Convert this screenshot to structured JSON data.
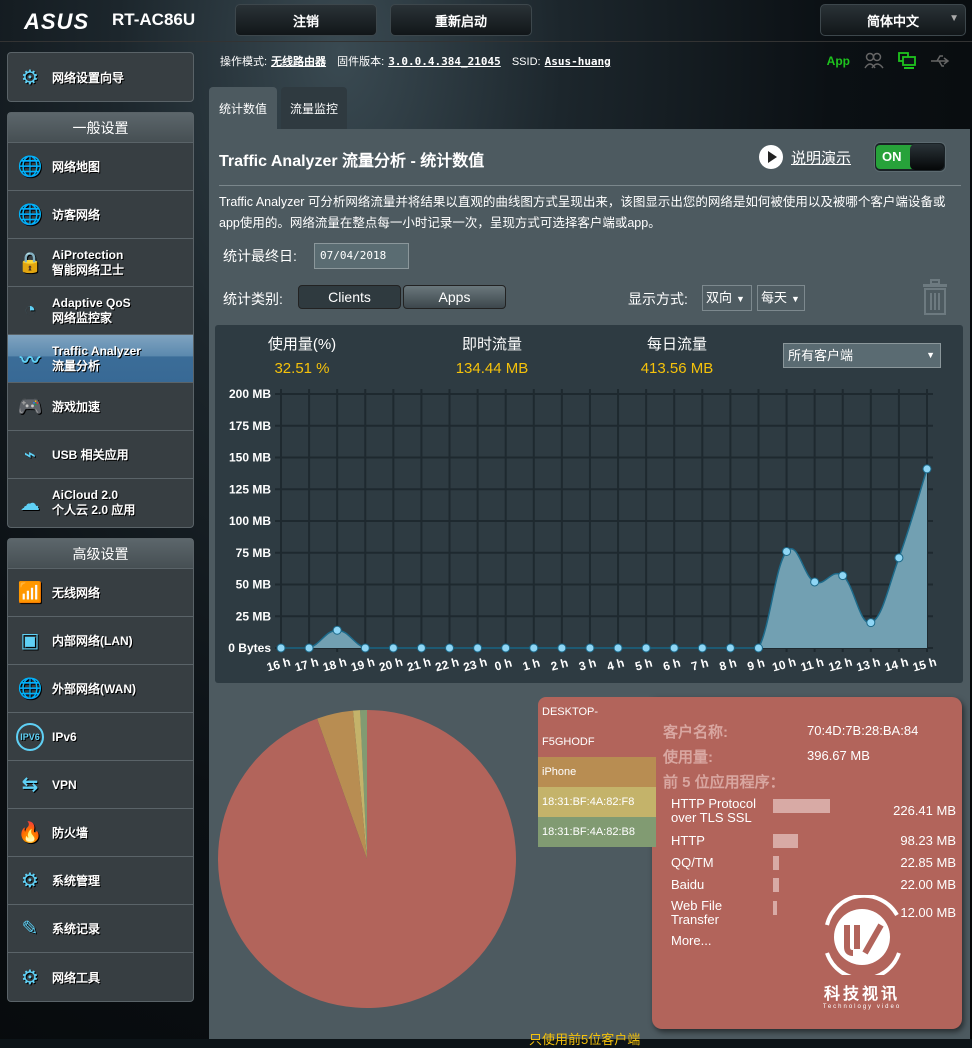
{
  "header": {
    "brand": "ASUS",
    "model": "RT-AC86U",
    "logout_label": "注销",
    "reboot_label": "重新启动",
    "language": "简体中文"
  },
  "status": {
    "mode_label": "操作模式:",
    "mode_value": "无线路由器",
    "firmware_label": "固件版本:",
    "firmware_value": "3.0.0.4.384_21045",
    "ssid_label": "SSID:",
    "ssid_value": "Asus-huang",
    "app_label": "App"
  },
  "sidebar": {
    "wizard": "网络设置向导",
    "general_title": "一般设置",
    "general": [
      {
        "label": "网络地图",
        "icon": "globe-pin-icon"
      },
      {
        "label": "访客网络",
        "icon": "guest-network-icon"
      },
      {
        "label": "AiProtection",
        "sub": "智能网络卫士",
        "icon": "shield-lock-icon"
      },
      {
        "label": "Adaptive QoS",
        "sub": "网络监控家",
        "icon": "speedometer-icon"
      },
      {
        "label": "Traffic Analyzer",
        "sub": "流量分析",
        "icon": "traffic-wave-icon",
        "active": true
      },
      {
        "label": "游戏加速",
        "icon": "gamepad-icon"
      },
      {
        "label": "USB 相关应用",
        "icon": "usb-icon"
      },
      {
        "label": "AiCloud 2.0",
        "sub": "个人云 2.0 应用",
        "icon": "cloud-icon"
      }
    ],
    "advanced_title": "高级设置",
    "advanced": [
      {
        "label": "无线网络",
        "icon": "wireless-icon"
      },
      {
        "label": "内部网络(LAN)",
        "icon": "lan-port-icon"
      },
      {
        "label": "外部网络(WAN)",
        "icon": "globe-icon"
      },
      {
        "label": "IPv6",
        "icon": "ipv6-icon"
      },
      {
        "label": "VPN",
        "icon": "vpn-monitor-icon"
      },
      {
        "label": "防火墙",
        "icon": "firewall-icon"
      },
      {
        "label": "系统管理",
        "icon": "gear-wrench-icon"
      },
      {
        "label": "系统记录",
        "icon": "log-edit-icon"
      },
      {
        "label": "网络工具",
        "icon": "tool-gear-icon"
      }
    ]
  },
  "tabs": [
    {
      "label": "统计数值",
      "active": true
    },
    {
      "label": "流量监控",
      "active": false
    }
  ],
  "main": {
    "title": "Traffic Analyzer 流量分析 - 统计数值",
    "demo_label": "说明演示",
    "toggle_label": "ON",
    "description": "Traffic Analyzer 可分析网络流量并将结果以直观的曲线图方式呈现出来，该图显示出您的网络是如何被使用以及被哪个客户端设备或app使用的。网络流量在整点每一小时记录一次，呈现方式可选择客户端或app。",
    "date_label": "统计最终日:",
    "date_value": "07/04/2018",
    "category_label": "统计类别:",
    "category_clients": "Clients",
    "category_apps": "Apps",
    "display_label": "显示方式:",
    "direction_value": "双向",
    "period_value": "每天"
  },
  "stats": {
    "usage_label": "使用量(%)",
    "usage_value": "32.51 %",
    "realtime_label": "即时流量",
    "realtime_value": "134.44 MB",
    "daily_label": "每日流量",
    "daily_value": "413.56 MB",
    "client_filter": "所有客户端"
  },
  "chart_data": [
    {
      "type": "area",
      "title": "",
      "xlabel": "",
      "ylabel": "",
      "x": [
        "16 h",
        "17 h",
        "18 h",
        "19 h",
        "20 h",
        "21 h",
        "22 h",
        "23 h",
        "0 h",
        "1 h",
        "2 h",
        "3 h",
        "4 h",
        "5 h",
        "6 h",
        "7 h",
        "8 h",
        "9 h",
        "10 h",
        "11 h",
        "12 h",
        "13 h",
        "14 h",
        "15 h"
      ],
      "values": [
        0,
        0,
        14,
        0,
        0,
        0,
        0,
        0,
        0,
        0,
        0,
        0,
        0,
        0,
        0,
        0,
        0,
        0,
        76,
        52,
        57,
        20,
        71,
        141
      ],
      "unit": "MB",
      "ylim": [
        0,
        200
      ],
      "yticks": [
        0,
        25,
        50,
        75,
        100,
        125,
        150,
        175,
        200
      ],
      "ytick_labels": [
        "0 Bytes",
        "25 MB",
        "50 MB",
        "75 MB",
        "100 MB",
        "125 MB",
        "150 MB",
        "175 MB",
        "200 MB"
      ],
      "grid": true,
      "color": "#72a0b2"
    },
    {
      "type": "pie",
      "labels": [
        "DESKTOP-F5GHODF",
        "iPhone",
        "18:31:BF:4A:82:F8",
        "18:31:BF:4A:82:B8"
      ],
      "values": [
        396.67,
        16.5,
        3.2,
        3.1
      ],
      "colors": [
        "#b2645b",
        "#b88d52",
        "#c4b36a",
        "#819b72"
      ]
    }
  ],
  "legend": [
    {
      "label": "DESKTOP-\nF5GHODF",
      "color": "#b2645b"
    },
    {
      "label": "iPhone",
      "color": "#b88d52"
    },
    {
      "label": "18:31:BF:4A:82:F8",
      "color": "#c4b36a"
    },
    {
      "label": "18:31:BF:4A:82:B8",
      "color": "#819b72"
    }
  ],
  "detail": {
    "client_label": "客户名称:",
    "client_value": "70:4D:7B:28:BA:84",
    "usage_label": "使用量:",
    "usage_value": "396.67 MB",
    "top_apps_label": "前 5 位应用程序：",
    "apps": [
      {
        "name": "HTTP Protocol over TLS SSL",
        "value": "226.41 MB",
        "ratio": 1.0
      },
      {
        "name": "HTTP",
        "value": "98.23 MB",
        "ratio": 0.43
      },
      {
        "name": "QQ/TM",
        "value": "22.85 MB",
        "ratio": 0.1
      },
      {
        "name": "Baidu",
        "value": "22.00 MB",
        "ratio": 0.1
      },
      {
        "name": "Web File Transfer",
        "value": "12.00 MB",
        "ratio": 0.05
      }
    ],
    "more_label": "More...",
    "watermark": "科技视讯",
    "watermark_sub": "Technology video"
  },
  "footer_note": "只使用前5位客户端"
}
